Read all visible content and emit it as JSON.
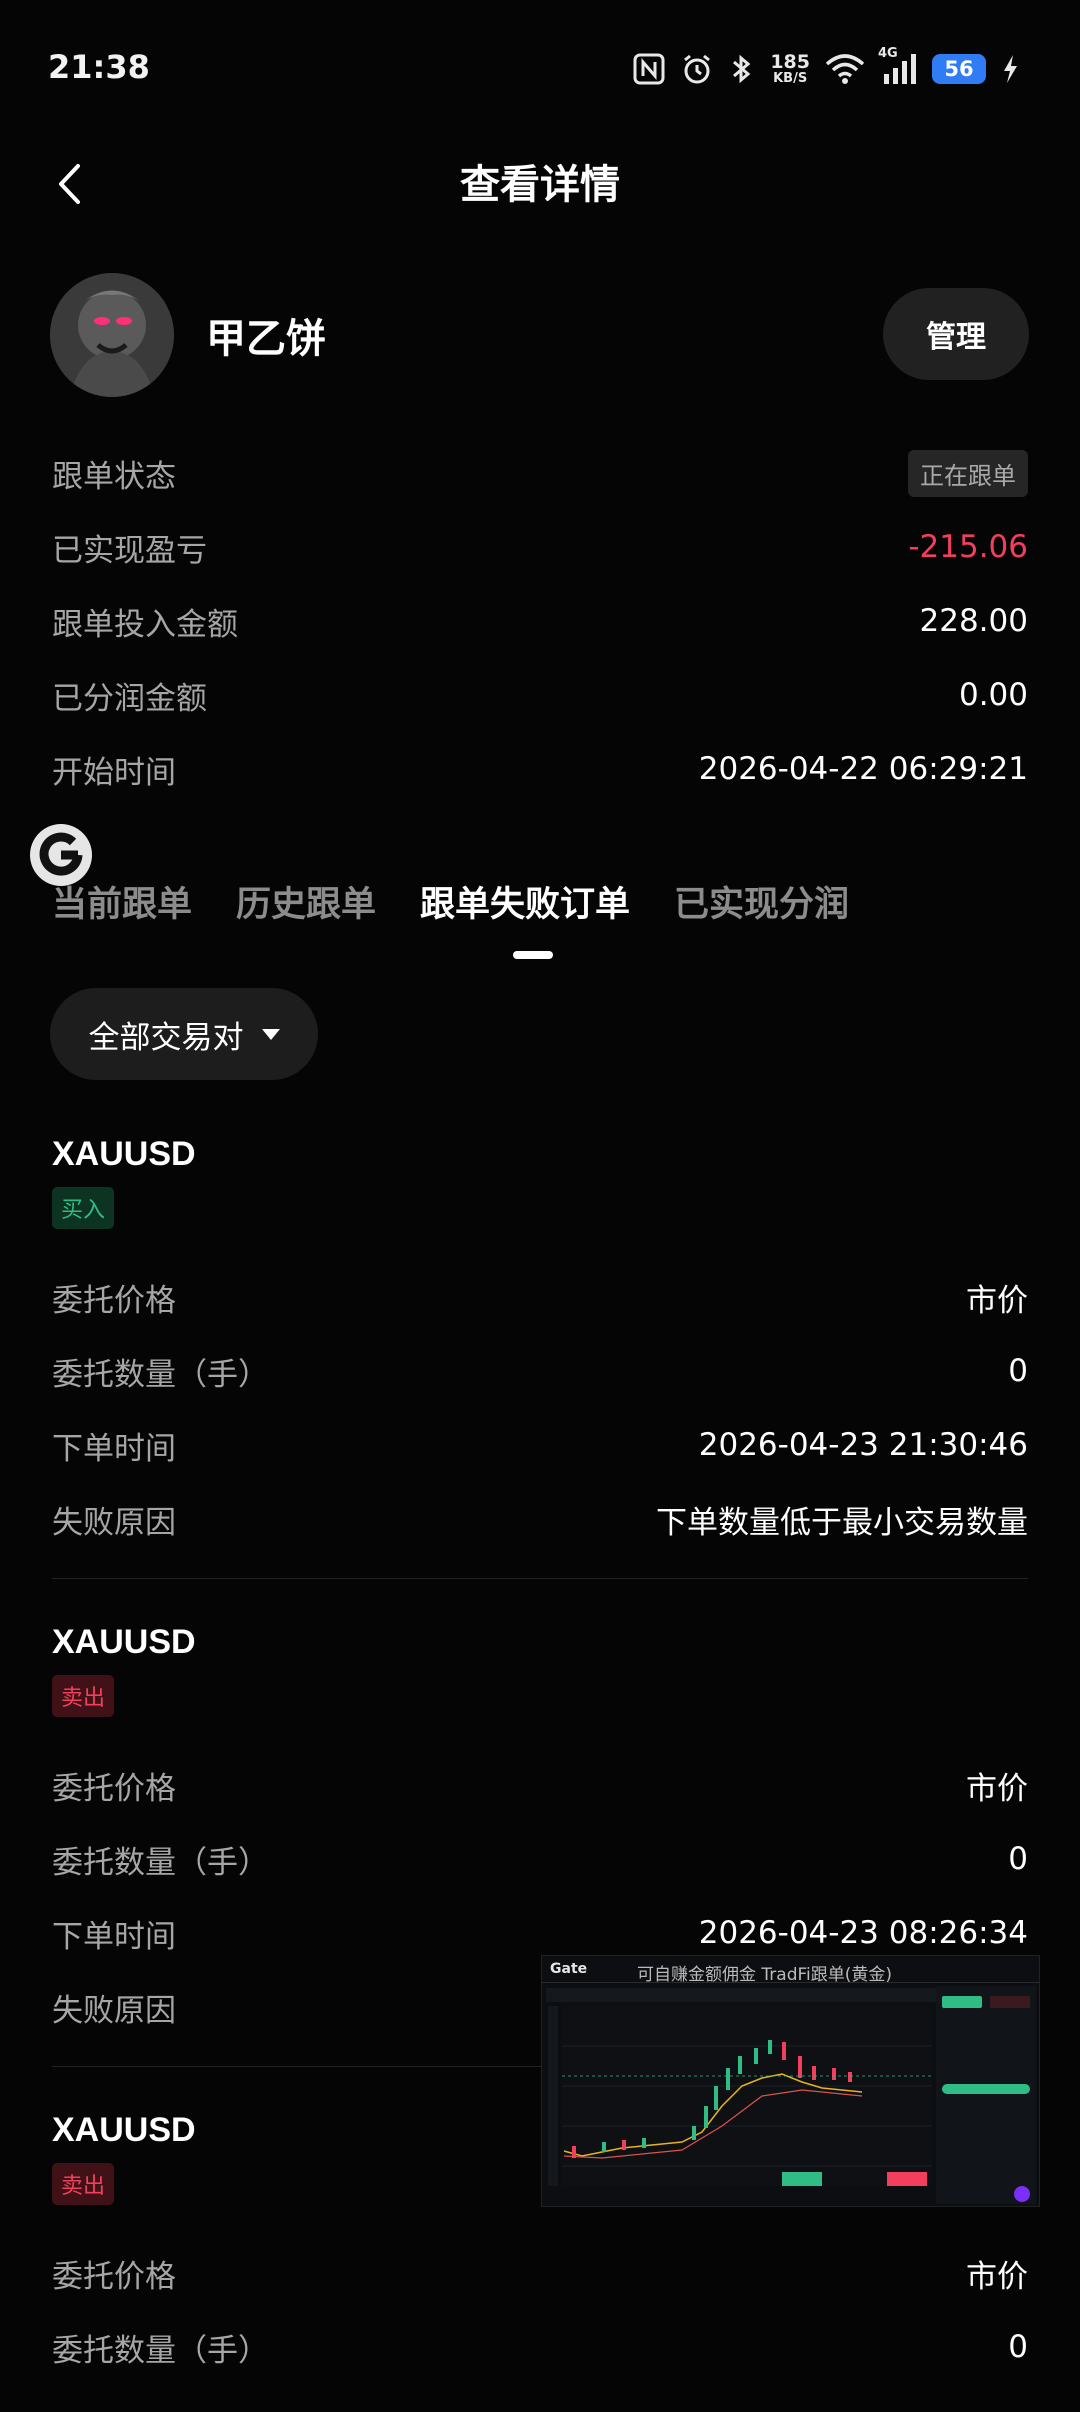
{
  "status_bar": {
    "time": "21:38",
    "net_speed_value": "185",
    "net_speed_unit": "KB/S",
    "network": "4G",
    "battery": "56",
    "icons": [
      "nfc-icon",
      "alarm-icon",
      "bluetooth-icon",
      "wifi-icon",
      "signal-icon",
      "charging-icon"
    ]
  },
  "header": {
    "title": "查看详情",
    "back_icon": "chevron-left-icon"
  },
  "trader": {
    "name": "甲乙饼",
    "manage_label": "管理"
  },
  "summary": [
    {
      "label": "跟单状态",
      "value": "正在跟单",
      "kind": "badge"
    },
    {
      "label": "已实现盈亏",
      "value": "-215.06",
      "kind": "negative"
    },
    {
      "label": "跟单投入金额",
      "value": "228.00",
      "kind": "plain"
    },
    {
      "label": "已分润金额",
      "value": "0.00",
      "kind": "plain"
    },
    {
      "label": "开始时间",
      "value": "2026-04-22 06:29:21",
      "kind": "plain"
    }
  ],
  "tabs": [
    {
      "label": "当前跟单",
      "active": false
    },
    {
      "label": "历史跟单",
      "active": false
    },
    {
      "label": "跟单失败订单",
      "active": true
    },
    {
      "label": "已实现分润",
      "active": false
    }
  ],
  "filter": {
    "label": "全部交易对"
  },
  "orders": [
    {
      "symbol": "XAUUSD",
      "side": "买入",
      "side_type": "buy",
      "rows": [
        {
          "label": "委托价格",
          "value": "市价"
        },
        {
          "label": "委托数量（手）",
          "value": "0"
        },
        {
          "label": "下单时间",
          "value": "2026-04-23 21:30:46"
        },
        {
          "label": "失败原因",
          "value": "下单数量低于最小交易数量"
        }
      ]
    },
    {
      "symbol": "XAUUSD",
      "side": "卖出",
      "side_type": "sell",
      "rows": [
        {
          "label": "委托价格",
          "value": "市价"
        },
        {
          "label": "委托数量（手）",
          "value": "0"
        },
        {
          "label": "下单时间",
          "value": "2026-04-23 08:26:34"
        },
        {
          "label": "失败原因",
          "value": ""
        }
      ]
    },
    {
      "symbol": "XAUUSD",
      "side": "卖出",
      "side_type": "sell",
      "rows": [
        {
          "label": "委托价格",
          "value": "市价"
        },
        {
          "label": "委托数量（手）",
          "value": "0"
        }
      ]
    }
  ],
  "pip_window": {
    "logo": "Gate",
    "title": "可自赚金额佣金 TradFi跟单(黄金)"
  },
  "colors": {
    "negative": "#f23f5d",
    "positive": "#2fbd85",
    "battery": "#2f7cf5",
    "background": "#050505"
  }
}
